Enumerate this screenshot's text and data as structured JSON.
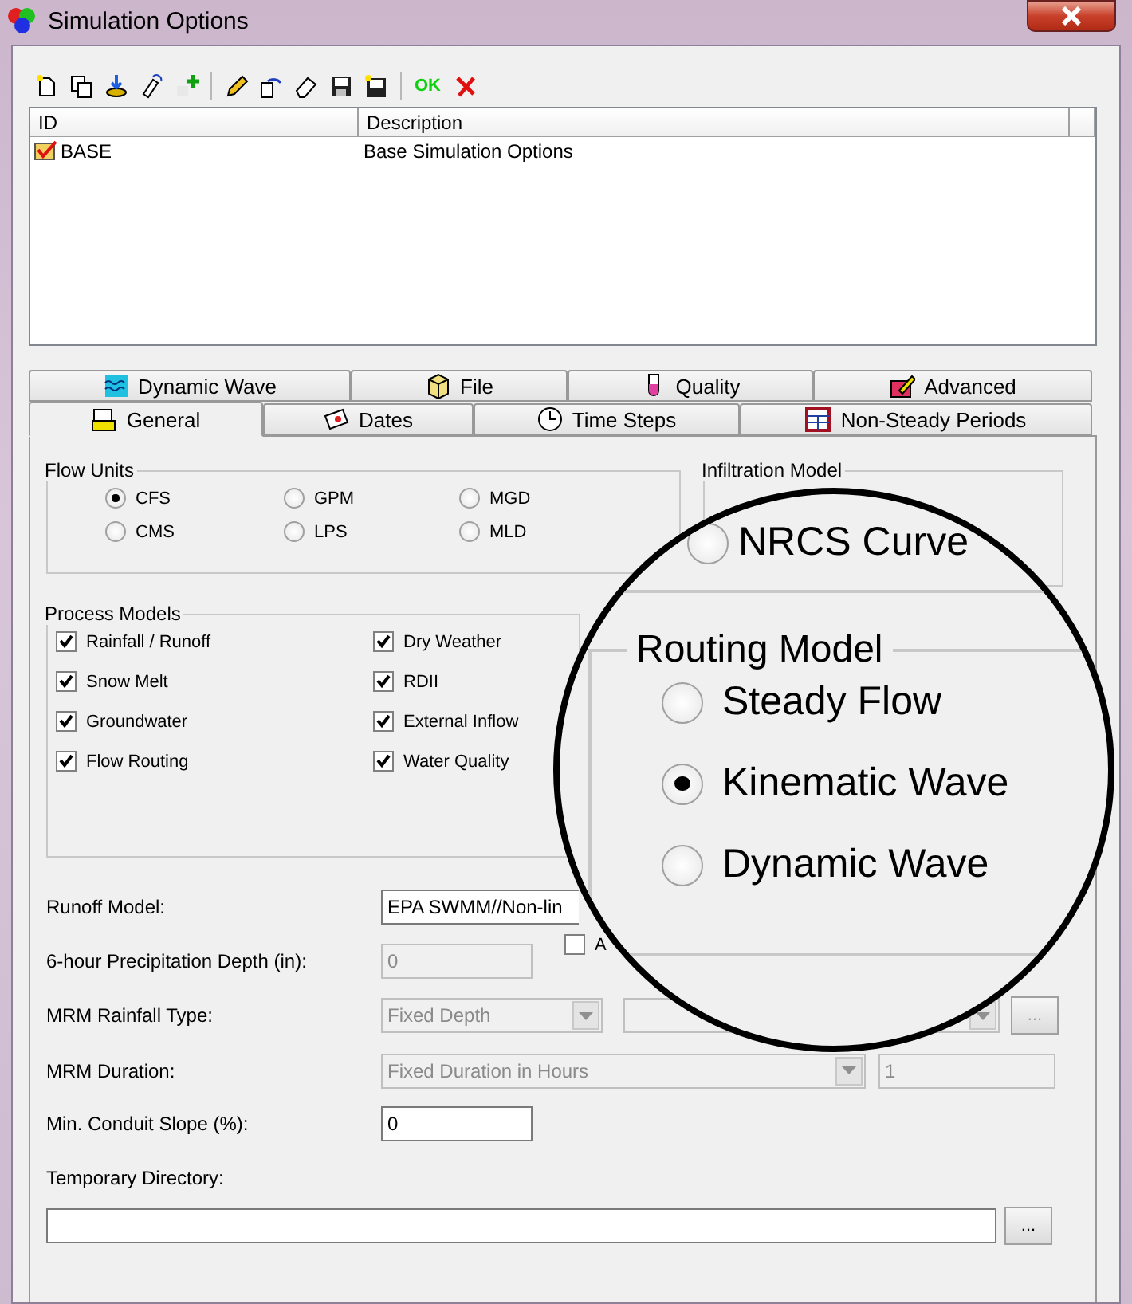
{
  "window": {
    "title": "Simulation Options"
  },
  "toolbar": [
    {
      "kind": "new"
    },
    {
      "kind": "copy"
    },
    {
      "kind": "import"
    },
    {
      "kind": "link"
    },
    {
      "kind": "id-add"
    },
    {
      "kind": "edit"
    },
    {
      "kind": "undo"
    },
    {
      "kind": "erase"
    },
    {
      "kind": "save"
    },
    {
      "kind": "save-as"
    },
    {
      "kind": "ok",
      "label": "OK"
    },
    {
      "kind": "cancel"
    }
  ],
  "list": {
    "columns": [
      "ID",
      "Description"
    ],
    "rows": [
      {
        "id": "BASE",
        "description": "Base Simulation Options",
        "checked": true
      }
    ]
  },
  "tabs": [
    [
      {
        "label": "Dynamic Wave",
        "selected": false
      },
      {
        "label": "File",
        "selected": false
      },
      {
        "label": "Quality",
        "selected": false
      },
      {
        "label": "Advanced",
        "selected": false
      }
    ],
    [
      {
        "label": "General",
        "selected": true
      },
      {
        "label": "Dates",
        "selected": false
      },
      {
        "label": "Time Steps",
        "selected": false
      },
      {
        "label": "Non-Steady Periods",
        "selected": false
      }
    ]
  ],
  "flow_units": {
    "title": "Flow Units",
    "options": [
      {
        "label": "CFS",
        "selected": true
      },
      {
        "label": "GPM",
        "selected": false
      },
      {
        "label": "MGD",
        "selected": false
      },
      {
        "label": "CMS",
        "selected": false
      },
      {
        "label": "LPS",
        "selected": false
      },
      {
        "label": "MLD",
        "selected": false
      }
    ]
  },
  "infiltration_model": {
    "title": "Infiltration Model"
  },
  "process_models": {
    "title": "Process Models",
    "items": [
      {
        "label": "Rainfall / Runoff",
        "checked": true
      },
      {
        "label": "Dry Weather",
        "checked": true
      },
      {
        "label": "Snow Melt",
        "checked": true
      },
      {
        "label": "RDII",
        "checked": true
      },
      {
        "label": "Groundwater",
        "checked": true
      },
      {
        "label": "External Inflow",
        "checked": true
      },
      {
        "label": "Flow Routing",
        "checked": true
      },
      {
        "label": "Water Quality",
        "checked": true
      }
    ]
  },
  "form": {
    "runoff_model": {
      "label": "Runoff Model:",
      "value": "EPA SWMM//Non-lin"
    },
    "precip_depth": {
      "label": "6-hour Precipitation Depth (in):",
      "value": "0",
      "disabled": true,
      "option": {
        "label": "A",
        "checked": false
      }
    },
    "mrm_rainfall_type": {
      "label": "MRM Rainfall Type:",
      "value": "Fixed Depth",
      "disabled": true,
      "button": "..."
    },
    "mrm_duration": {
      "label": "MRM Duration:",
      "value": "Fixed Duration in Hours",
      "number": "1",
      "disabled": true
    },
    "min_slope": {
      "label": "Min. Conduit Slope (%):",
      "value": "0",
      "disabled": false
    },
    "temp_dir": {
      "label": "Temporary Directory:",
      "button": "..."
    }
  },
  "magnifier": {
    "infiltration_option": {
      "label": "NRCS Curve",
      "selected": false
    },
    "routing_model": {
      "title": "Routing Model",
      "options": [
        {
          "label": "Steady Flow",
          "selected": false
        },
        {
          "label": "Kinematic Wave",
          "selected": true
        },
        {
          "label": "Dynamic Wave",
          "selected": false
        }
      ]
    }
  }
}
